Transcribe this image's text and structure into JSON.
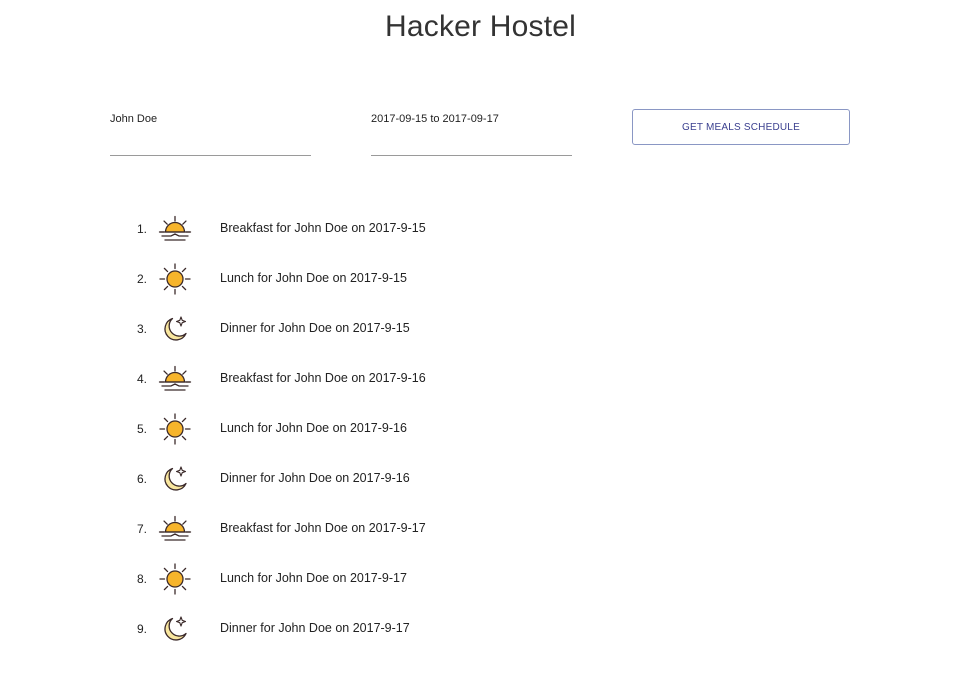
{
  "header": {
    "title": "Hacker Hostel"
  },
  "form": {
    "name_value": "John Doe",
    "date_range_value": "2017-09-15 to 2017-09-17",
    "button_label": "GET MEALS SCHEDULE"
  },
  "icon_colors": {
    "sun_fill": "#f7b52c",
    "moon_fill": "#f9e79f",
    "stroke": "#3b2a2a"
  },
  "meals": [
    {
      "number": "1.",
      "icon": "sunrise-icon",
      "text": "Breakfast for John Doe on 2017-9-15"
    },
    {
      "number": "2.",
      "icon": "sun-icon",
      "text": "Lunch for John Doe on 2017-9-15"
    },
    {
      "number": "3.",
      "icon": "moon-icon",
      "text": "Dinner for John Doe on 2017-9-15"
    },
    {
      "number": "4.",
      "icon": "sunrise-icon",
      "text": "Breakfast for John Doe on 2017-9-16"
    },
    {
      "number": "5.",
      "icon": "sun-icon",
      "text": "Lunch for John Doe on 2017-9-16"
    },
    {
      "number": "6.",
      "icon": "moon-icon",
      "text": "Dinner for John Doe on 2017-9-16"
    },
    {
      "number": "7.",
      "icon": "sunrise-icon",
      "text": "Breakfast for John Doe on 2017-9-17"
    },
    {
      "number": "8.",
      "icon": "sun-icon",
      "text": "Lunch for John Doe on 2017-9-17"
    },
    {
      "number": "9.",
      "icon": "moon-icon",
      "text": "Dinner for John Doe on 2017-9-17"
    }
  ]
}
